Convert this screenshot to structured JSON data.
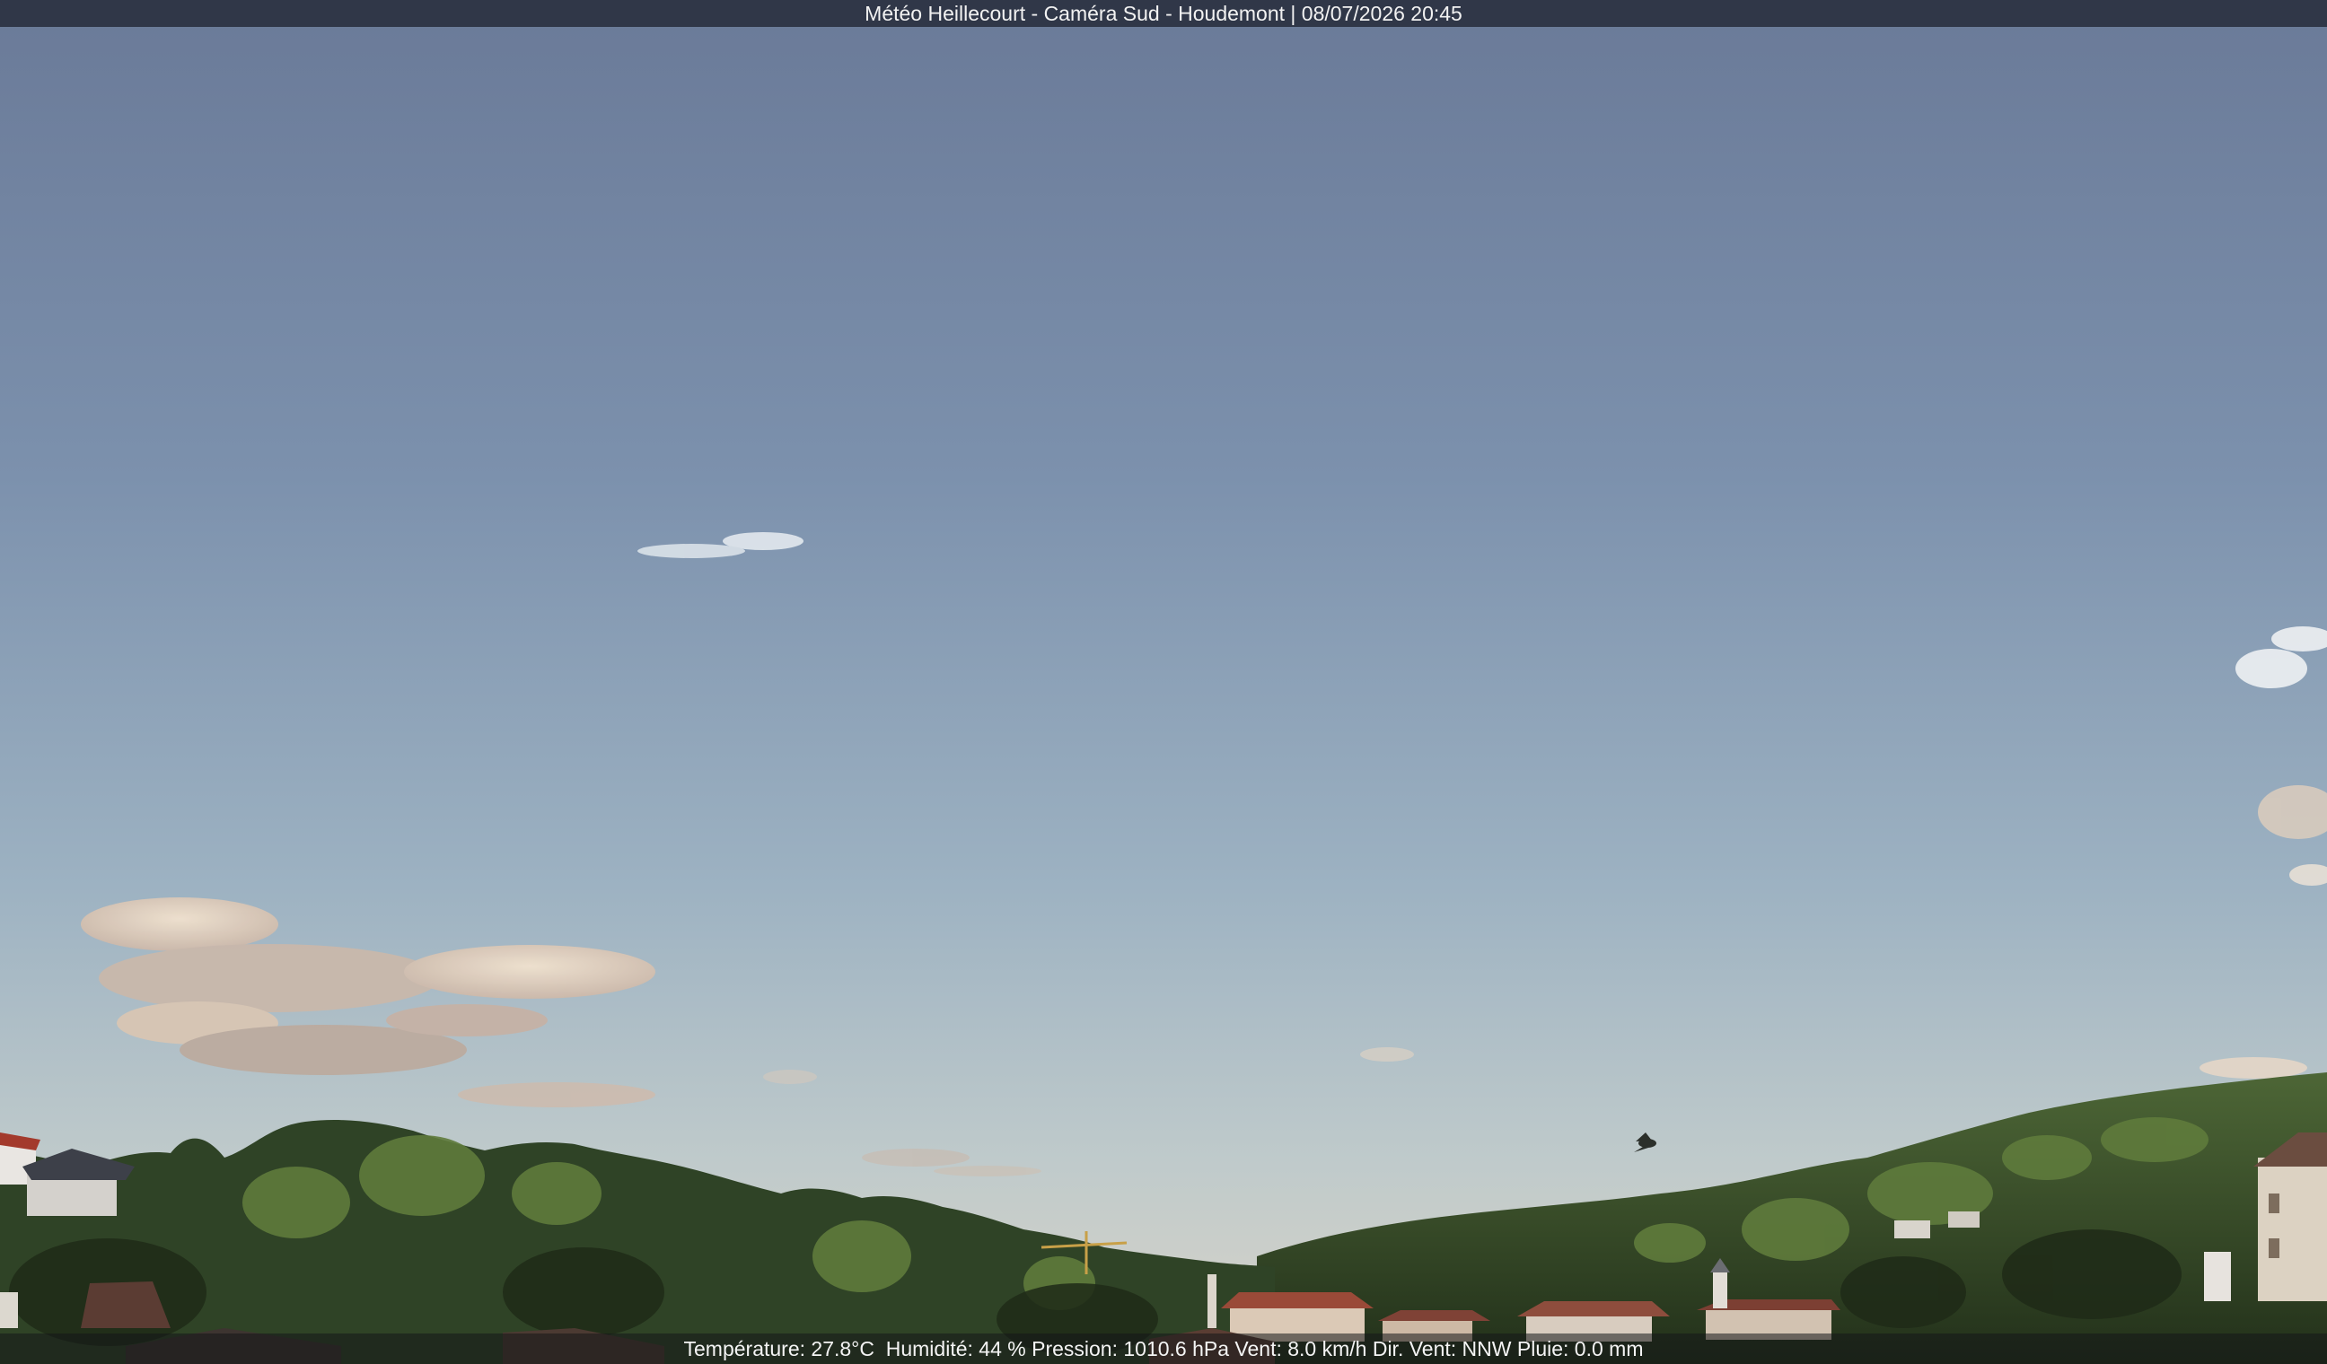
{
  "overlay": {
    "title": "Météo Heillecourt - Caméra Sud - Houdemont | 08/07/2026 20:45",
    "weather_line": "Température: 27.8°C  Humidité: 44 % Pression: 1010.6 hPa Vent: 8.0 km/h Dir. Vent: NNW Pluie: 0.0 mm"
  },
  "colors": {
    "sky_top": "#6e7f9c",
    "sky_mid": "#8ca3b8",
    "sky_horizon": "#c9d1cf",
    "cloud": "#e9d9c8",
    "foliage_dark": "#2a3a20",
    "foliage_light": "#6f8a45",
    "roof": "#8a4a3a"
  }
}
